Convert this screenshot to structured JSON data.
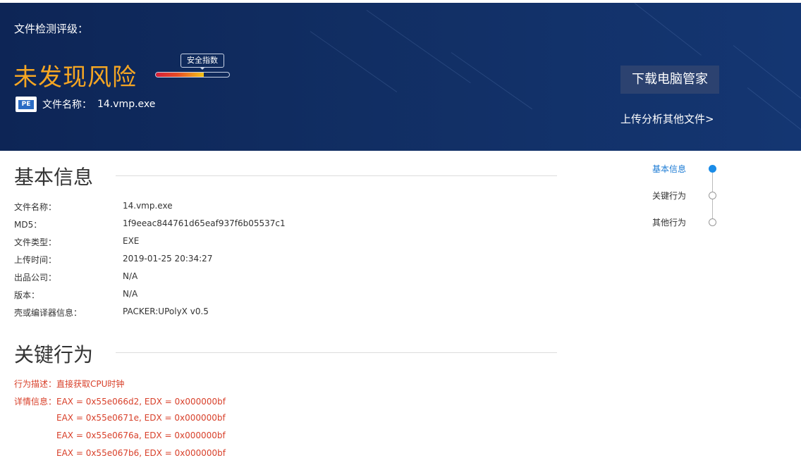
{
  "banner": {
    "grade_label": "文件检测评级：",
    "risk_text": "未发现风险",
    "score_tag": "安全指数",
    "score_fraction": 0.65,
    "file_icon": "pe-file-icon",
    "file_icon_text": "PE",
    "file_name_label": "文件名称：",
    "file_name_value": "14.vmp.exe",
    "download_button": "下载电脑管家",
    "upload_link": "上传分析其他文件>"
  },
  "basic_info": {
    "title": "基本信息",
    "rows": [
      {
        "label": "文件名称：",
        "value": "14.vmp.exe"
      },
      {
        "label": "MD5：",
        "value": "1f9eeac844761d65eaf937f6b05537c1"
      },
      {
        "label": "文件类型：",
        "value": "EXE"
      },
      {
        "label": "上传时间：",
        "value": "2019-01-25 20:34:27"
      },
      {
        "label": "出品公司：",
        "value": "N/A"
      },
      {
        "label": "版本：",
        "value": "N/A"
      },
      {
        "label": "壳或编译器信息：",
        "value": "PACKER:UPolyX v0.5"
      }
    ]
  },
  "key_behavior": {
    "title": "关键行为",
    "desc_label": "行为描述：",
    "desc_value": "直接获取CPU时钟",
    "detail_label": "详情信息：",
    "details": [
      "EAX = 0x55e066d2, EDX = 0x000000bf",
      "EAX = 0x55e0671e, EDX = 0x000000bf",
      "EAX = 0x55e0676a, EDX = 0x000000bf",
      "EAX = 0x55e067b6, EDX = 0x000000bf"
    ]
  },
  "side_nav": {
    "items": [
      {
        "label": "基本信息",
        "active": true
      },
      {
        "label": "关键行为",
        "active": false
      },
      {
        "label": "其他行为",
        "active": false
      }
    ]
  },
  "colors": {
    "banner_bg": "#0f2a5c",
    "risk": "#f5a623",
    "accent": "#1a7ad4",
    "alert": "#d8402a"
  }
}
